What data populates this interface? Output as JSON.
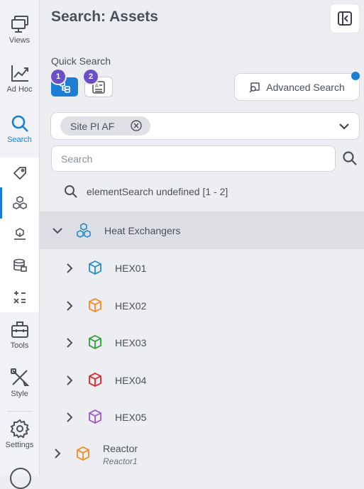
{
  "rail": {
    "items": [
      {
        "name": "views",
        "label": "Views",
        "icon": "monitor-stack-icon"
      },
      {
        "name": "adhoc",
        "label": "Ad Hoc",
        "icon": "trend-chart-icon"
      },
      {
        "name": "search",
        "label": "Search",
        "icon": "search-icon",
        "active": true
      },
      {
        "name": "tools",
        "label": "Tools",
        "icon": "toolbox-icon"
      },
      {
        "name": "style",
        "label": "Style",
        "icon": "style-tools-icon"
      },
      {
        "name": "settings",
        "label": "Settings",
        "icon": "gear-icon"
      }
    ],
    "search_subitems": [
      "tag-icon",
      "assets-icon",
      "asset-template-icon",
      "database-icon",
      "calculator-icon"
    ]
  },
  "panel": {
    "title": "Search: Assets",
    "quick_search_label": "Quick Search",
    "quick_buttons": [
      {
        "badge": "1",
        "icon": "asset-hierarchy-icon",
        "active": true
      },
      {
        "badge": "2",
        "icon": "template-attribute-icon",
        "active": false
      }
    ],
    "advanced_search_label": "Advanced Search",
    "source_chip": "Site PI AF",
    "search_placeholder": "Search",
    "search_value": "",
    "result_summary": "elementSearch undefined [1 - 2]"
  },
  "tree": {
    "parent": {
      "label": "Heat Exchangers",
      "expanded": true
    },
    "children": [
      {
        "label": "HEX01",
        "color": "#2a8cc9"
      },
      {
        "label": "HEX02",
        "color": "#f28b22"
      },
      {
        "label": "HEX03",
        "color": "#2f9e3a"
      },
      {
        "label": "HEX04",
        "color": "#d9262b"
      },
      {
        "label": "HEX05",
        "color": "#9b59c9"
      }
    ],
    "second_root": {
      "label": "Reactor",
      "sublabel": "Reactor1",
      "color": "#f28b22"
    }
  },
  "colors": {
    "accent": "#1a7fd4",
    "badge": "#6b4fc9",
    "icon_gray": "#4b5059"
  }
}
